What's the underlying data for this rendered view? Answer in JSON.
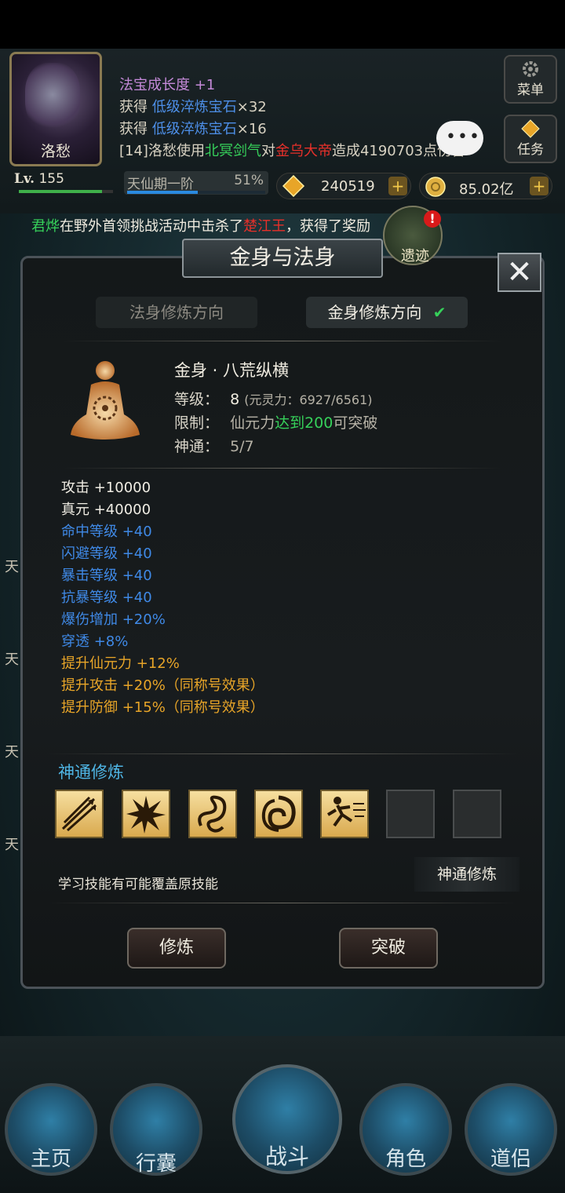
{
  "player": {
    "name": "洛愁",
    "level_label": "Lv.",
    "level": "155",
    "level_progress": 0.88,
    "realm": "天仙期一阶",
    "realm_percent_text": "51%",
    "realm_progress": 0.51
  },
  "log": [
    {
      "prefix": "法宝成长度",
      "value": " +1"
    },
    {
      "prefix": "获得 ",
      "item": "低级淬炼宝石",
      "value": "×32"
    },
    {
      "prefix": "获得 ",
      "item": "低级淬炼宝石",
      "value": "×16"
    },
    {
      "prefix": "[14]洛愁使用",
      "skill": "北冥剑气",
      "mid": "对",
      "target": "金乌大帝",
      "suffix": "造成4190703点伤害"
    }
  ],
  "menu_button": "菜单",
  "task_button": "任务",
  "currency": {
    "gems": "240519",
    "coins": "85.02亿"
  },
  "broadcast": {
    "player": "君烨",
    "text1": "在野外首领挑战活动中击杀了",
    "boss": "楚江王",
    "text2": "，获得了奖励"
  },
  "relic_label": "遗迹",
  "relic_badge": "!",
  "panel": {
    "title": "金身与法身",
    "close": "✕",
    "tabs": {
      "fashen": "法身修炼方向",
      "jinshen": "金身修炼方向",
      "active_check": "✔"
    },
    "body_name": "金身 · 八荒纵横",
    "level_label": "等级：",
    "level_value": "8",
    "level_extra": "(元灵力：6927/6561)",
    "limit_label": "限制：",
    "limit_a": "仙元力",
    "limit_b": "达到200",
    "limit_c": "可突破",
    "shentong_label": "神通：",
    "shentong_value": "5/7",
    "stats": [
      {
        "name": "攻击",
        "value": " +10000",
        "color": "white"
      },
      {
        "name": "真元",
        "value": " +40000",
        "color": "white"
      },
      {
        "name": "命中等级",
        "value": " +40",
        "color": "blue"
      },
      {
        "name": "闪避等级",
        "value": " +40",
        "color": "blue"
      },
      {
        "name": "暴击等级",
        "value": " +40",
        "color": "blue"
      },
      {
        "name": "抗暴等级",
        "value": " +40",
        "color": "blue"
      },
      {
        "name": "爆伤增加",
        "value": " +20%",
        "color": "blue"
      },
      {
        "name": "穿透",
        "value": " +8%",
        "color": "blue"
      },
      {
        "name": "提升仙元力",
        "value": " +12%",
        "color": "orange"
      },
      {
        "name": "提升攻击",
        "value": " +20%（同称号效果）",
        "color": "orange"
      },
      {
        "name": "提升防御",
        "value": " +15%（同称号效果）",
        "color": "orange"
      }
    ],
    "skill_section_title": "神通修炼",
    "skill_icons": [
      "arrows-icon",
      "burst-icon",
      "serpent-icon",
      "vortex-icon",
      "dash-icon",
      "empty",
      "empty"
    ],
    "warning": "学习技能有可能覆盖原技能",
    "learn_button": "神通修炼",
    "train_button": "修炼",
    "breakthrough_button": "突破"
  },
  "side_chars": [
    "天",
    "天",
    "天",
    "天"
  ],
  "nav": [
    {
      "label": "主页"
    },
    {
      "label": "行囊"
    },
    {
      "label": "战斗"
    },
    {
      "label": "角色"
    },
    {
      "label": "道侣"
    }
  ],
  "colors": {
    "accent_gold": "#e8a528",
    "stat_blue": "#3f89e6",
    "highlight_green": "#36d05a",
    "alert_red": "#e8302a"
  }
}
